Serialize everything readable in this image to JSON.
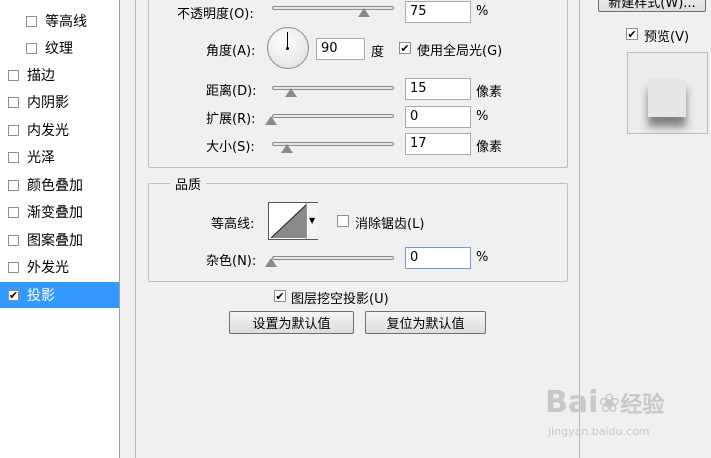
{
  "styles_list": {
    "items": [
      {
        "label": "等高线",
        "checked": false,
        "indent": true
      },
      {
        "label": "纹理",
        "checked": false,
        "indent": true
      },
      {
        "label": "描边",
        "checked": false
      },
      {
        "label": "内阴影",
        "checked": false
      },
      {
        "label": "内发光",
        "checked": false
      },
      {
        "label": "光泽",
        "checked": false
      },
      {
        "label": "颜色叠加",
        "checked": false
      },
      {
        "label": "渐变叠加",
        "checked": false
      },
      {
        "label": "图案叠加",
        "checked": false
      },
      {
        "label": "外发光",
        "checked": false
      },
      {
        "label": "投影",
        "checked": true,
        "selected": true
      }
    ]
  },
  "structure": {
    "opacity": {
      "label": "不透明度(O):",
      "value": "75",
      "unit": "%"
    },
    "angle": {
      "label": "角度(A):",
      "value": "90",
      "unit": "度",
      "global_light_label": "使用全局光(G)",
      "global_light_checked": true
    },
    "distance": {
      "label": "距离(D):",
      "value": "15",
      "unit": "像素"
    },
    "spread": {
      "label": "扩展(R):",
      "value": "0",
      "unit": "%"
    },
    "size": {
      "label": "大小(S):",
      "value": "17",
      "unit": "像素"
    }
  },
  "quality": {
    "title": "品质",
    "contour_label": "等高线:",
    "antialias_label": "消除锯齿(L)",
    "antialias_checked": false,
    "noise": {
      "label": "杂色(N):",
      "value": "0",
      "unit": "%"
    }
  },
  "knockout": {
    "label": "图层挖空投影(U)",
    "checked": true
  },
  "buttons": {
    "make_default": "设置为默认值",
    "reset_default": "复位为默认值"
  },
  "right_panel": {
    "new_style": "新建样式(W)...",
    "preview_label": "预览(V)",
    "preview_checked": true
  },
  "watermark": {
    "brand": "Bai",
    "brand2": "经验",
    "url": "jingyan.baidu.com"
  }
}
